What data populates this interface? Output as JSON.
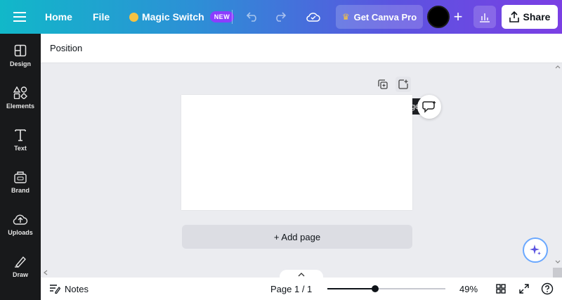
{
  "topbar": {
    "home": "Home",
    "file": "File",
    "magic_switch": "Magic Switch",
    "new_badge": "NEW",
    "get_pro": "Get Canva Pro",
    "share": "Share"
  },
  "sidebar": {
    "items": [
      {
        "label": "Design",
        "icon": "layout-icon"
      },
      {
        "label": "Elements",
        "icon": "shapes-icon"
      },
      {
        "label": "Text",
        "icon": "text-icon"
      },
      {
        "label": "Brand",
        "icon": "brand-icon"
      },
      {
        "label": "Uploads",
        "icon": "upload-icon"
      },
      {
        "label": "Draw",
        "icon": "draw-icon"
      }
    ]
  },
  "subbar": {
    "position": "Position"
  },
  "canvas": {
    "tooltip": "Add page",
    "add_page_button": "+ Add page"
  },
  "footer": {
    "notes": "Notes",
    "page_info": "Page 1 / 1",
    "zoom": "49%",
    "zoom_fraction": 0.49
  },
  "colors": {
    "accent": "#8b3dff",
    "sidebar_bg": "#18191b",
    "workspace_bg": "#ebecf0"
  }
}
